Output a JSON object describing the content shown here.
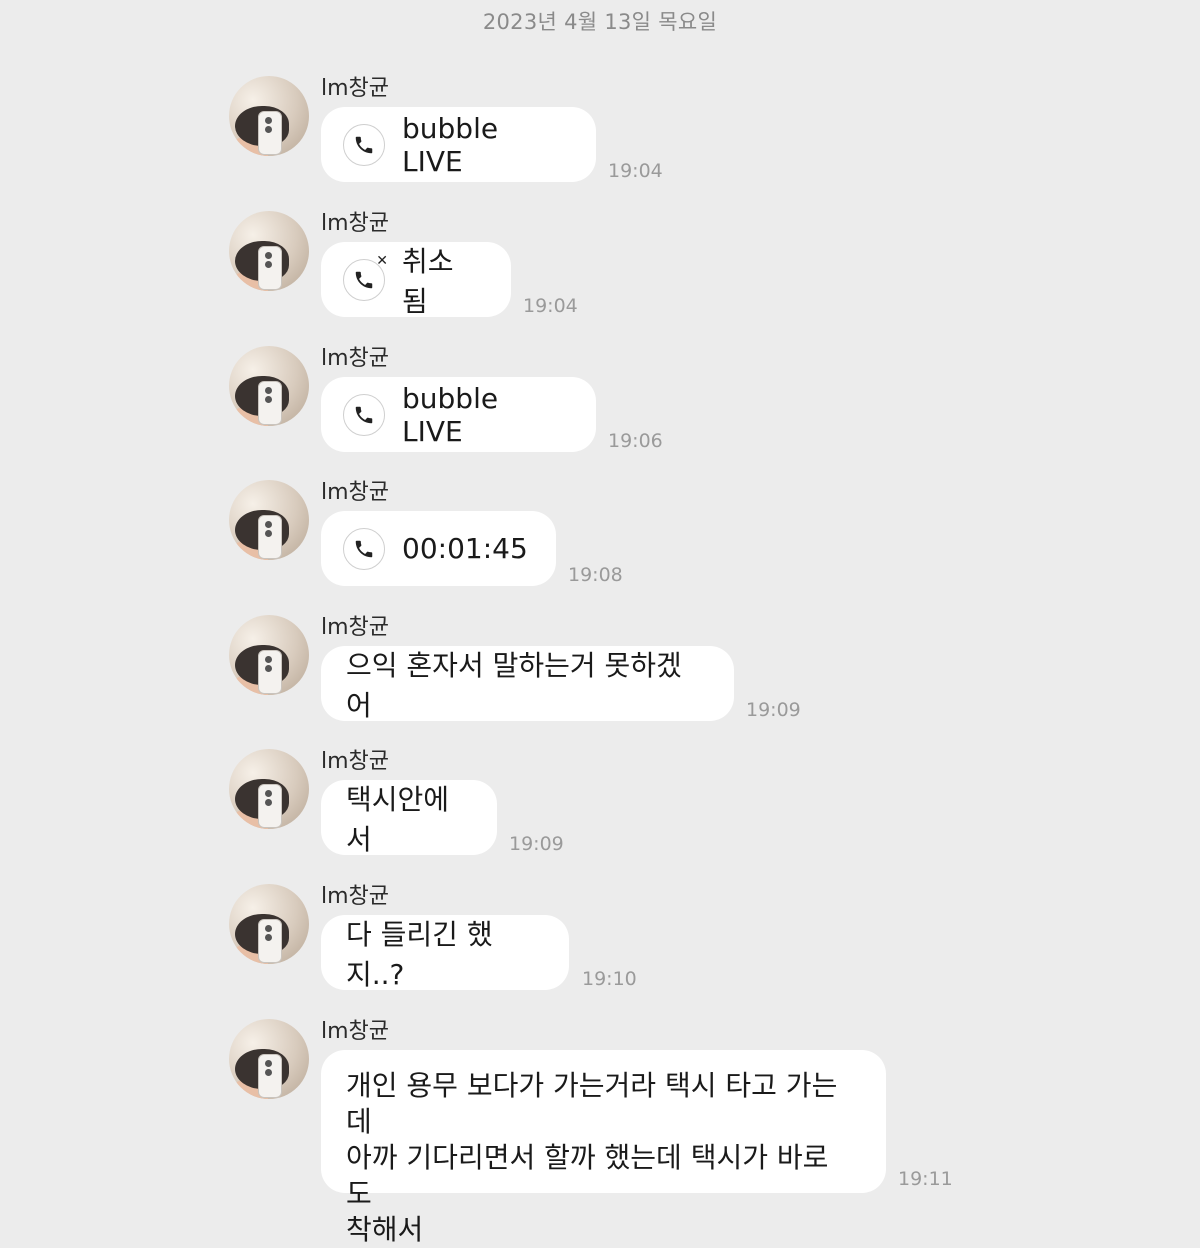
{
  "date_header": "2023년 4월 13일 목요일",
  "messages": [
    {
      "sender": "lm창균",
      "type": "call",
      "icon": "phone-icon",
      "text": "bubble LIVE",
      "time": "19:04"
    },
    {
      "sender": "lm창균",
      "type": "call",
      "icon": "phone-cancelled-icon",
      "text": "취소됨",
      "time": "19:04"
    },
    {
      "sender": "lm창균",
      "type": "call",
      "icon": "phone-icon",
      "text": "bubble LIVE",
      "time": "19:06"
    },
    {
      "sender": "lm창균",
      "type": "call",
      "icon": "phone-icon",
      "text": "00:01:45",
      "time": "19:08"
    },
    {
      "sender": "lm창균",
      "type": "text",
      "text": "으익 혼자서 말하는거 못하겠어",
      "time": "19:09"
    },
    {
      "sender": "lm창균",
      "type": "text",
      "text": "택시안에서",
      "time": "19:09"
    },
    {
      "sender": "lm창균",
      "type": "text",
      "text": "다 들리긴 했지..?",
      "time": "19:10"
    },
    {
      "sender": "lm창균",
      "type": "text",
      "lines": [
        "개인 용무 보다가 가는거라 택시 타고 가는데",
        "아까 기다리면서 할까 했는데 택시가 바로 도",
        "착해서"
      ],
      "time": "19:11"
    }
  ]
}
